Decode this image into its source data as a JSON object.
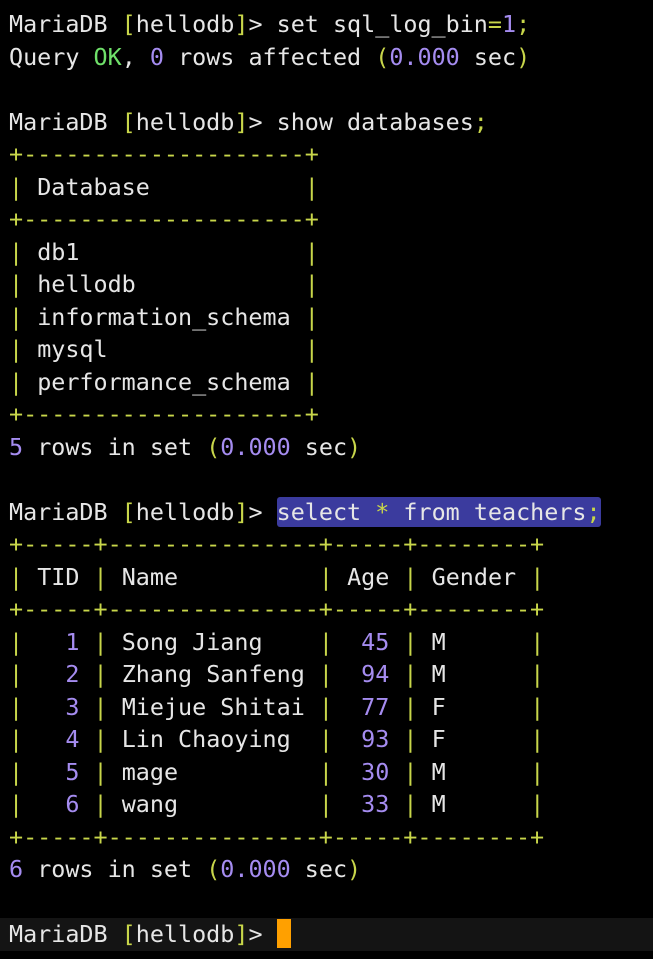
{
  "prompt": {
    "client": "MariaDB",
    "open_bracket": "[",
    "database": "hellodb",
    "close_bracket": "]",
    "arrow": ">"
  },
  "commands": {
    "set_log": {
      "text_a": "set sql_log_bin",
      "equals": "=",
      "value": "1",
      "semicolon": ";"
    },
    "show_databases": {
      "text": "show databases",
      "semicolon": ";"
    },
    "select_teachers": {
      "text_a": "select",
      "star": "*",
      "text_b": "from teachers",
      "semicolon": ";"
    }
  },
  "query_ok": {
    "prefix": "Query",
    "ok": "OK",
    "comma": ",",
    "count": "0",
    "rest": "rows affected",
    "open_paren": "(",
    "time": "0.000",
    "unit": "sec",
    "close_paren": ")"
  },
  "databases_table": {
    "border": "+--------------------+",
    "header": "Database",
    "rows": [
      "db1",
      "hellodb",
      "information_schema",
      "mysql",
      "performance_schema"
    ],
    "footer": {
      "count": "5",
      "rest": "rows in set",
      "open_paren": "(",
      "time": "0.000",
      "unit": "sec",
      "close_paren": ")"
    }
  },
  "teachers_table": {
    "border": "+-----+---------------+-----+--------+",
    "headers": [
      "TID",
      "Name",
      "Age",
      "Gender"
    ],
    "rows": [
      {
        "tid": "1",
        "name": "Song Jiang",
        "age": "45",
        "gender": "M"
      },
      {
        "tid": "2",
        "name": "Zhang Sanfeng",
        "age": "94",
        "gender": "M"
      },
      {
        "tid": "3",
        "name": "Miejue Shitai",
        "age": "77",
        "gender": "F"
      },
      {
        "tid": "4",
        "name": "Lin Chaoying",
        "age": "93",
        "gender": "F"
      },
      {
        "tid": "5",
        "name": "mage",
        "age": "30",
        "gender": "M"
      },
      {
        "tid": "6",
        "name": "wang",
        "age": "33",
        "gender": "M"
      }
    ],
    "footer": {
      "count": "6",
      "rest": "rows in set",
      "open_paren": "(",
      "time": "0.000",
      "unit": "sec",
      "close_paren": ")"
    }
  },
  "colors": {
    "background": "#000000",
    "text": "#e6e6e6",
    "punctuation": "#c8d64a",
    "ok": "#6fe06a",
    "number": "#a58cf0",
    "selection": "#3b3b9e",
    "cursor": "#ffa000"
  }
}
